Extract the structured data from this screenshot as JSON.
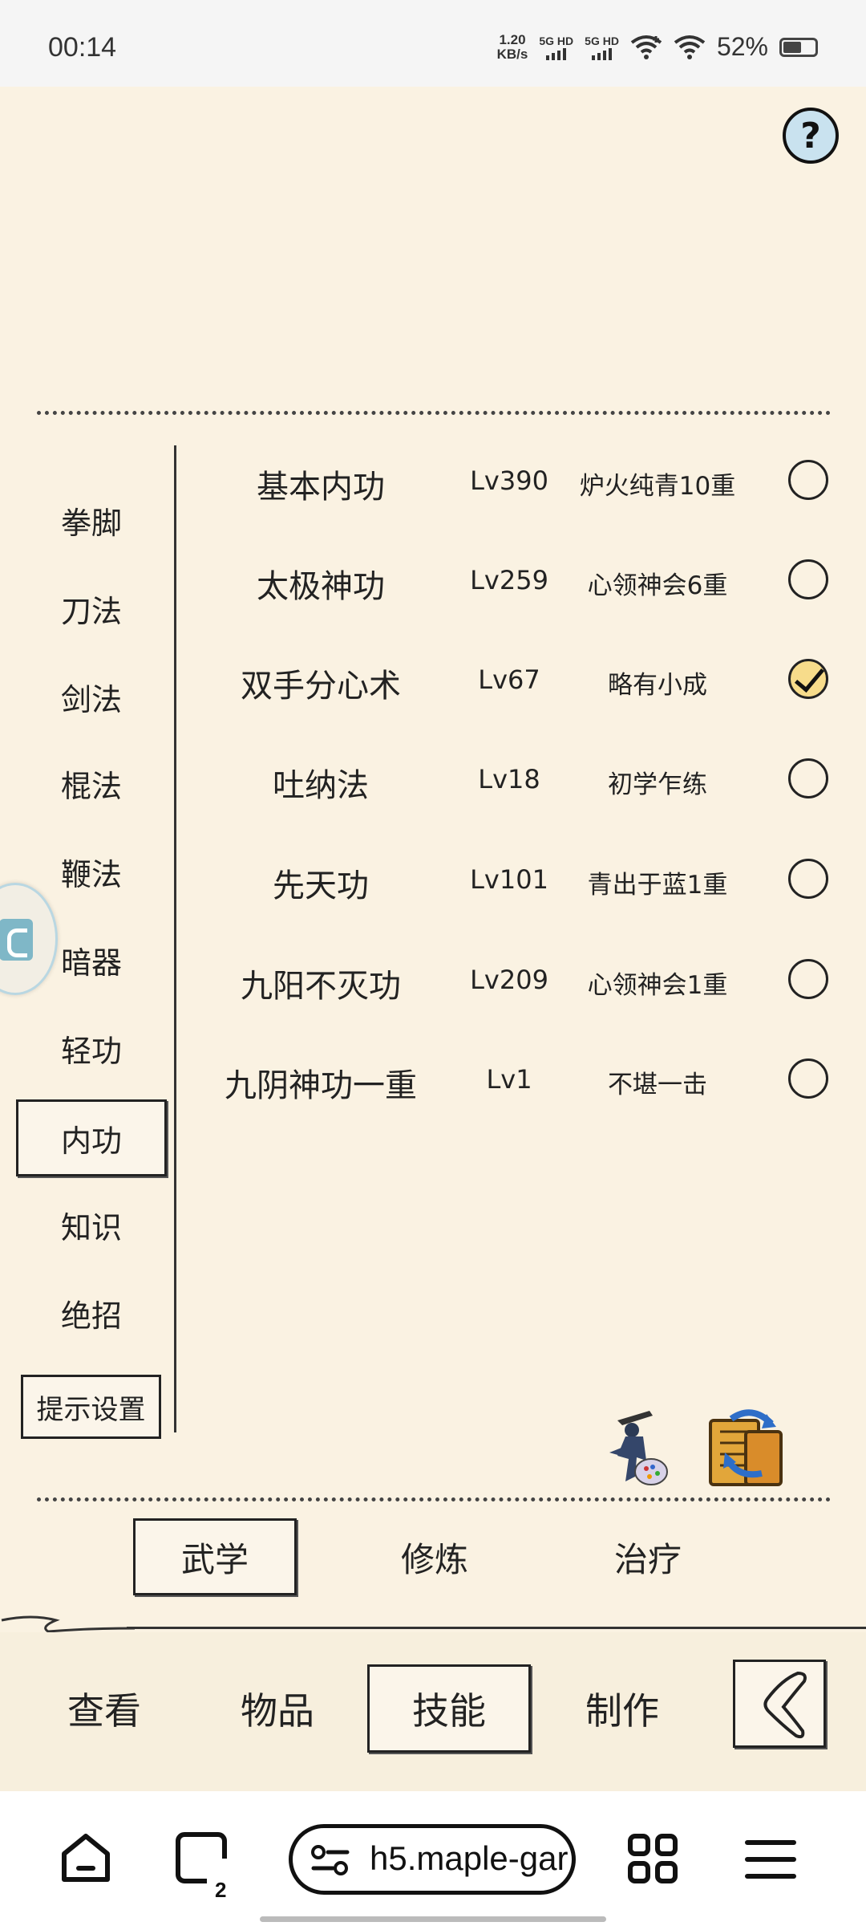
{
  "status_bar": {
    "time": "00:14",
    "net_speed_value": "1.20",
    "net_speed_unit": "KB/s",
    "sim1_label": "5G HD",
    "sim2_label": "5G HD",
    "battery_percent": "52%",
    "battery_level": 0.52
  },
  "sidebar": {
    "items": [
      {
        "label": "拳脚"
      },
      {
        "label": "刀法"
      },
      {
        "label": "剑法"
      },
      {
        "label": "棍法"
      },
      {
        "label": "鞭法"
      },
      {
        "label": "暗器"
      },
      {
        "label": "轻功"
      },
      {
        "label": "内功",
        "active": true
      },
      {
        "label": "知识"
      },
      {
        "label": "绝招"
      }
    ],
    "hint_settings_label": "提示设置"
  },
  "skills": [
    {
      "name": "基本内功",
      "level": "Lv390",
      "rank": "炉火纯青10重",
      "checked": false
    },
    {
      "name": "太极神功",
      "level": "Lv259",
      "rank": "心领神会6重",
      "checked": false
    },
    {
      "name": "双手分心术",
      "level": "Lv67",
      "rank": "略有小成",
      "checked": true
    },
    {
      "name": "吐纳法",
      "level": "Lv18",
      "rank": "初学乍练",
      "checked": false
    },
    {
      "name": "先天功",
      "level": "Lv101",
      "rank": "青出于蓝1重",
      "checked": false
    },
    {
      "name": "九阳不灭功",
      "level": "Lv209",
      "rank": "心领神会1重",
      "checked": false
    },
    {
      "name": "九阴神功一重",
      "level": "Lv1",
      "rank": "不堪一击",
      "checked": false
    }
  ],
  "tabs": [
    {
      "label": "武学",
      "active": true
    },
    {
      "label": "修炼"
    },
    {
      "label": "治疗"
    }
  ],
  "bottom_nav": [
    {
      "label": "查看"
    },
    {
      "label": "物品"
    },
    {
      "label": "技能",
      "active": true
    },
    {
      "label": "制作"
    }
  ],
  "help_label": "?",
  "browser": {
    "url": "h5.maple-gar",
    "tab_count": "2"
  }
}
